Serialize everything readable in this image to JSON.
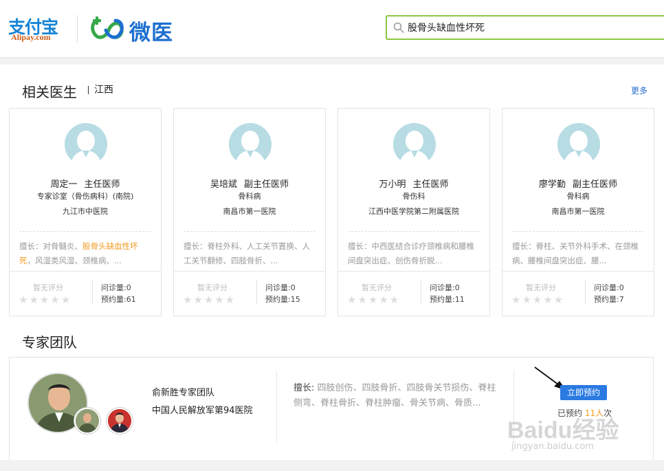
{
  "header": {
    "alipay_logo": {
      "text_cn": "支付宝",
      "text_en": "Alipay.com"
    },
    "weiyi_logo": {
      "text": "微医"
    },
    "search": {
      "value": "股骨头缺血性坏死"
    }
  },
  "doctors_section": {
    "title": "相关医生",
    "region": "江西",
    "more": "更多",
    "doctors": [
      {
        "name": "周定一",
        "title": "主任医师",
        "dept": "专家诊室（骨伤病科）(南院)",
        "hospital": "九江市中医院",
        "spec_prefix": "擅长：对骨髓炎、",
        "spec_highlight": "股骨头缺血性坏死",
        "spec_suffix": "，风湿类风湿、颈椎病、...",
        "rating": "暂无评分",
        "consults": "问诊量:0",
        "bookings": "预约量:61"
      },
      {
        "name": "吴培斌",
        "title": "副主任医师",
        "dept": "骨科病",
        "hospital": "南昌市第一医院",
        "spec_prefix": "擅长：脊柱外科、人工关节置换、人工关节翻修、四肢骨折、...",
        "spec_highlight": "",
        "spec_suffix": "",
        "rating": "暂无评分",
        "consults": "问诊量:0",
        "bookings": "预约量:15"
      },
      {
        "name": "万小明",
        "title": "主任医师",
        "dept": "骨伤科",
        "hospital": "江西中医学院第二附属医院",
        "spec_prefix": "擅长：中西医结合诊疗颈椎病和腰椎间盘突出症、创伤骨折脱...",
        "spec_highlight": "",
        "spec_suffix": "",
        "rating": "暂无评分",
        "consults": "问诊量:0",
        "bookings": "预约量:11"
      },
      {
        "name": "廖学勤",
        "title": "副主任医师",
        "dept": "骨科病",
        "hospital": "南昌市第一医院",
        "spec_prefix": "擅长：脊柱、关节外科手术、在颈椎病、腰椎间盘突出症、腰...",
        "spec_highlight": "",
        "spec_suffix": "",
        "rating": "暂无评分",
        "consults": "问诊量:0",
        "bookings": "预约量:7"
      }
    ],
    "stars": "★★★★★"
  },
  "team_section": {
    "title": "专家团队",
    "team": {
      "name": "俞新胜专家团队",
      "hospital": "中国人民解放军第94医院",
      "spec_label": "擅长:",
      "spec_text": "四肢创伤、四肢骨折、四肢骨关节损伤、脊柱侧弯、脊柱骨折、脊柱肿瘤、骨关节病、骨质...",
      "book_label": "立即预约",
      "booked_prefix": "已预约",
      "booked_count": "11人",
      "booked_suffix": "次"
    }
  },
  "watermark": {
    "text": "Baidu经验",
    "url": "jingyan.baidu.com"
  },
  "colors": {
    "accent_blue": "#2a7ae2",
    "highlight_orange": "#f39a1e",
    "search_border": "#8cc63f"
  }
}
